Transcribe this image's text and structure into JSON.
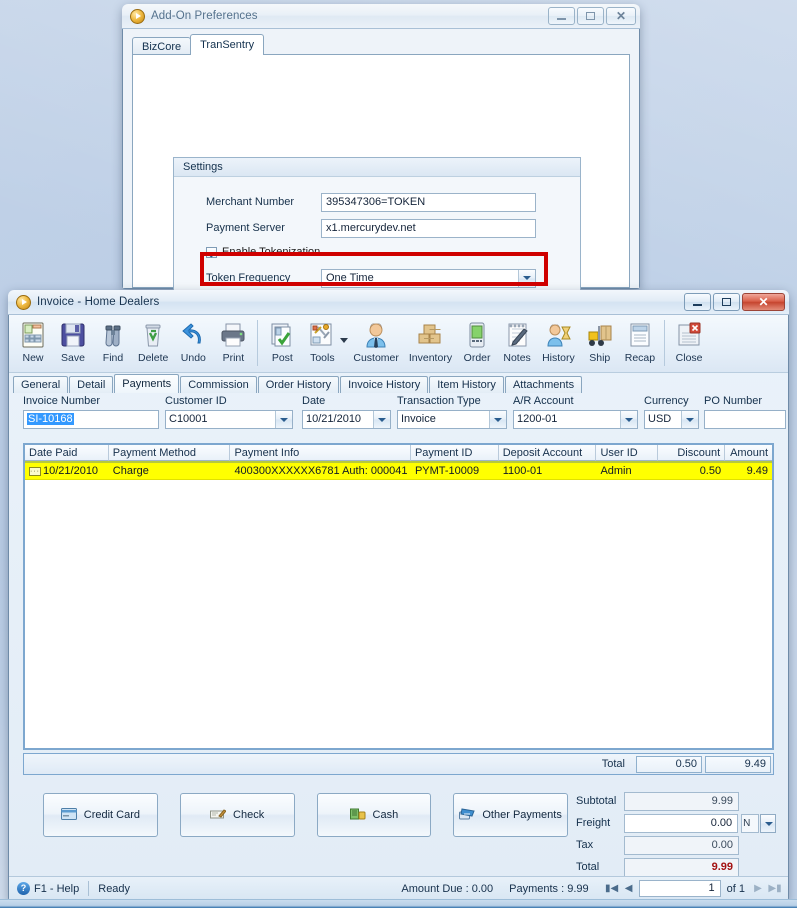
{
  "desktop": {
    "background_color": "#bccee6"
  },
  "prefs_window": {
    "title": "Add-On Preferences",
    "icon": "app-orb-icon",
    "window_buttons": {
      "minimize": "minimize-icon",
      "maximize": "maximize-icon",
      "close": "close-icon"
    },
    "tabs": [
      {
        "label": "BizCore",
        "selected": false
      },
      {
        "label": "TranSentry",
        "selected": true
      }
    ],
    "settings_group": {
      "title": "Settings",
      "fields": [
        {
          "label": "Merchant Number",
          "value": "395347306=TOKEN",
          "type": "text"
        },
        {
          "label": "Payment Server",
          "value": "x1.mercurydev.net",
          "type": "text"
        }
      ],
      "checkbox": {
        "label": "Enable Tokenization",
        "checked": true
      },
      "combo": {
        "label": "Token Frequency",
        "value": "One Time"
      }
    },
    "highlight_color": "#cf0000"
  },
  "invoice_window": {
    "title": "Invoice - Home Dealers",
    "icon": "app-orb-icon",
    "window_buttons": {
      "minimize": "minimize-icon",
      "maximize": "maximize-icon",
      "close": "close-icon"
    },
    "toolbar": [
      {
        "label": "New",
        "icon": "new-document-icon"
      },
      {
        "label": "Save",
        "icon": "floppy-disk-icon"
      },
      {
        "label": "Find",
        "icon": "binoculars-icon"
      },
      {
        "label": "Delete",
        "icon": "recycle-bin-icon"
      },
      {
        "label": "Undo",
        "icon": "undo-arrow-icon"
      },
      {
        "label": "Print",
        "icon": "printer-icon"
      },
      {
        "label": "Post",
        "icon": "post-check-icon"
      },
      {
        "label": "Tools",
        "icon": "tools-icon",
        "has_dropdown": true
      },
      {
        "label": "Customer",
        "icon": "customer-person-icon"
      },
      {
        "label": "Inventory",
        "icon": "boxes-icon"
      },
      {
        "label": "Order",
        "icon": "order-device-icon"
      },
      {
        "label": "Notes",
        "icon": "notepad-pen-icon"
      },
      {
        "label": "History",
        "icon": "history-hourglass-icon"
      },
      {
        "label": "Ship",
        "icon": "forklift-icon"
      },
      {
        "label": "Recap",
        "icon": "recap-report-icon"
      },
      {
        "label": "Close",
        "icon": "close-window-icon"
      }
    ],
    "tabs": [
      {
        "label": "General",
        "selected": false
      },
      {
        "label": "Detail",
        "selected": false
      },
      {
        "label": "Payments",
        "selected": true
      },
      {
        "label": "Commission",
        "selected": false
      },
      {
        "label": "Order History",
        "selected": false
      },
      {
        "label": "Invoice History",
        "selected": false
      },
      {
        "label": "Item History",
        "selected": false
      },
      {
        "label": "Attachments",
        "selected": false
      }
    ],
    "form_fields": [
      {
        "name": "invoice-number",
        "label": "Invoice Number",
        "value": "SI-10168",
        "type": "text",
        "selected_text": true
      },
      {
        "name": "customer-id",
        "label": "Customer ID",
        "value": "C10001",
        "type": "combo"
      },
      {
        "name": "date",
        "label": "Date",
        "value": "10/21/2010",
        "type": "combo"
      },
      {
        "name": "transaction-type",
        "label": "Transaction Type",
        "value": "Invoice",
        "type": "combo"
      },
      {
        "name": "ar-account",
        "label": "A/R Account",
        "value": "1200-01",
        "type": "combo"
      },
      {
        "name": "currency",
        "label": "Currency",
        "value": "USD",
        "type": "combo"
      },
      {
        "name": "po-number",
        "label": "PO Number",
        "value": "",
        "type": "text"
      }
    ],
    "grid": {
      "columns": [
        "Date Paid",
        "Payment Method",
        "Payment Info",
        "Payment ID",
        "Deposit Account",
        "User ID",
        "Discount",
        "Amount"
      ],
      "rows": [
        {
          "date_paid": "10/21/2010",
          "payment_method": "Charge",
          "payment_info": "400300XXXXXX6781 Auth: 000041",
          "payment_id": "PYMT-10009",
          "deposit_account": "1100-01",
          "user_id": "Admin",
          "discount": "0.50",
          "amount": "9.49",
          "row_color": "#ffff00"
        }
      ],
      "footer": {
        "label": "Total",
        "discount": "0.50",
        "amount": "9.49"
      }
    },
    "payment_buttons": [
      {
        "label": "Credit Card",
        "icon": "credit-card-icon"
      },
      {
        "label": "Check",
        "icon": "check-icon"
      },
      {
        "label": "Cash",
        "icon": "cash-icon"
      },
      {
        "label": "Other Payments",
        "icon": "other-payments-icon"
      }
    ],
    "summary": {
      "subtotal": {
        "label": "Subtotal",
        "value": "9.99"
      },
      "freight": {
        "label": "Freight",
        "value": "0.00",
        "tax_code": "N"
      },
      "tax": {
        "label": "Tax",
        "value": "0.00"
      },
      "total": {
        "label": "Total",
        "value": "9.99",
        "color": "#a31212"
      }
    },
    "statusbar": {
      "help": "F1 - Help",
      "help_icon": "question-help-icon",
      "status": "Ready",
      "amount_due": "Amount Due : 0.00",
      "payments": "Payments : 9.99",
      "nav": {
        "first": "first-record-icon",
        "prev": "previous-record-icon",
        "page": "1",
        "of_label": "of 1",
        "next": "next-record-icon",
        "last": "last-record-icon"
      }
    }
  }
}
